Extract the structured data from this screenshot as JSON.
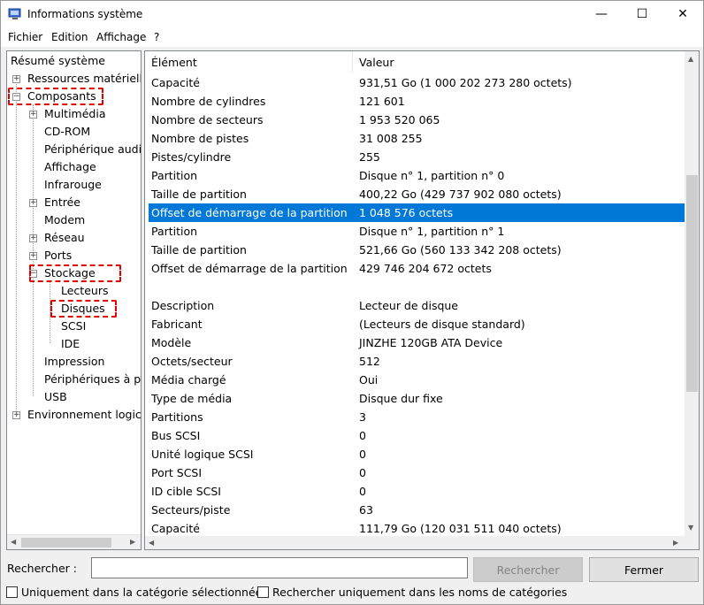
{
  "window": {
    "title": "Informations système",
    "minimize": "—",
    "maximize": "☐",
    "close": "✕"
  },
  "menu": [
    "Fichier",
    "Edition",
    "Affichage",
    "?"
  ],
  "tree": {
    "root": "Résumé système",
    "items": [
      {
        "label": "Ressources matérielle",
        "expander": "+"
      },
      {
        "label": "Composants",
        "expander": "−"
      },
      {
        "label": "Multimédia",
        "expander": "+"
      },
      {
        "label": "CD-ROM"
      },
      {
        "label": "Périphérique audio"
      },
      {
        "label": "Affichage"
      },
      {
        "label": "Infrarouge"
      },
      {
        "label": "Entrée",
        "expander": "+"
      },
      {
        "label": "Modem"
      },
      {
        "label": "Réseau",
        "expander": "+"
      },
      {
        "label": "Ports",
        "expander": "+"
      },
      {
        "label": "Stockage",
        "expander": "−"
      },
      {
        "label": "Lecteurs"
      },
      {
        "label": "Disques"
      },
      {
        "label": "SCSI"
      },
      {
        "label": "IDE"
      },
      {
        "label": "Impression"
      },
      {
        "label": "Périphériques à pr"
      },
      {
        "label": "USB"
      },
      {
        "label": "Environnement logicie",
        "expander": "+"
      }
    ]
  },
  "list": {
    "columns": [
      "Élément",
      "Valeur"
    ],
    "rows": [
      {
        "el": "Capacité",
        "val": "931,51 Go (1 000 202 273 280 octets)"
      },
      {
        "el": "Nombre de cylindres",
        "val": "121 601"
      },
      {
        "el": "Nombre de secteurs",
        "val": "1 953 520 065"
      },
      {
        "el": "Nombre de pistes",
        "val": "31 008 255"
      },
      {
        "el": "Pistes/cylindre",
        "val": "255"
      },
      {
        "el": "Partition",
        "val": "Disque n° 1, partition n° 0"
      },
      {
        "el": "Taille de partition",
        "val": "400,22 Go (429 737 902 080 octets)"
      },
      {
        "el": "Offset de démarrage de la partition",
        "val": "1 048 576 octets",
        "selected": true
      },
      {
        "el": "Partition",
        "val": "Disque n° 1, partition n° 1"
      },
      {
        "el": "Taille de partition",
        "val": "521,66 Go (560 133 342 208 octets)"
      },
      {
        "el": "Offset de démarrage de la partition",
        "val": "429 746 204 672 octets"
      },
      {
        "el": "",
        "val": ""
      },
      {
        "el": "Description",
        "val": "Lecteur de disque"
      },
      {
        "el": "Fabricant",
        "val": "(Lecteurs de disque standard)"
      },
      {
        "el": "Modèle",
        "val": "JINZHE 120GB ATA Device"
      },
      {
        "el": "Octets/secteur",
        "val": "512"
      },
      {
        "el": "Média chargé",
        "val": "Oui"
      },
      {
        "el": "Type de média",
        "val": "Disque dur fixe"
      },
      {
        "el": "Partitions",
        "val": "3"
      },
      {
        "el": "Bus SCSI",
        "val": "0"
      },
      {
        "el": "Unité logique SCSI",
        "val": "0"
      },
      {
        "el": "Port SCSI",
        "val": "0"
      },
      {
        "el": "ID cible SCSI",
        "val": "0"
      },
      {
        "el": "Secteurs/piste",
        "val": "63"
      },
      {
        "el": "Capacité",
        "val": "111,79 Go (120 031 511 040 octets)"
      }
    ]
  },
  "search": {
    "label": "Rechercher :",
    "value": "",
    "search_button": "Rechercher",
    "close_button": "Fermer",
    "opt_category": "Uniquement dans la catégorie sélectionnée",
    "opt_names": "Rechercher uniquement dans les noms de catégories"
  },
  "colors": {
    "selection": "#0078d7",
    "highlight": "#e00000"
  }
}
